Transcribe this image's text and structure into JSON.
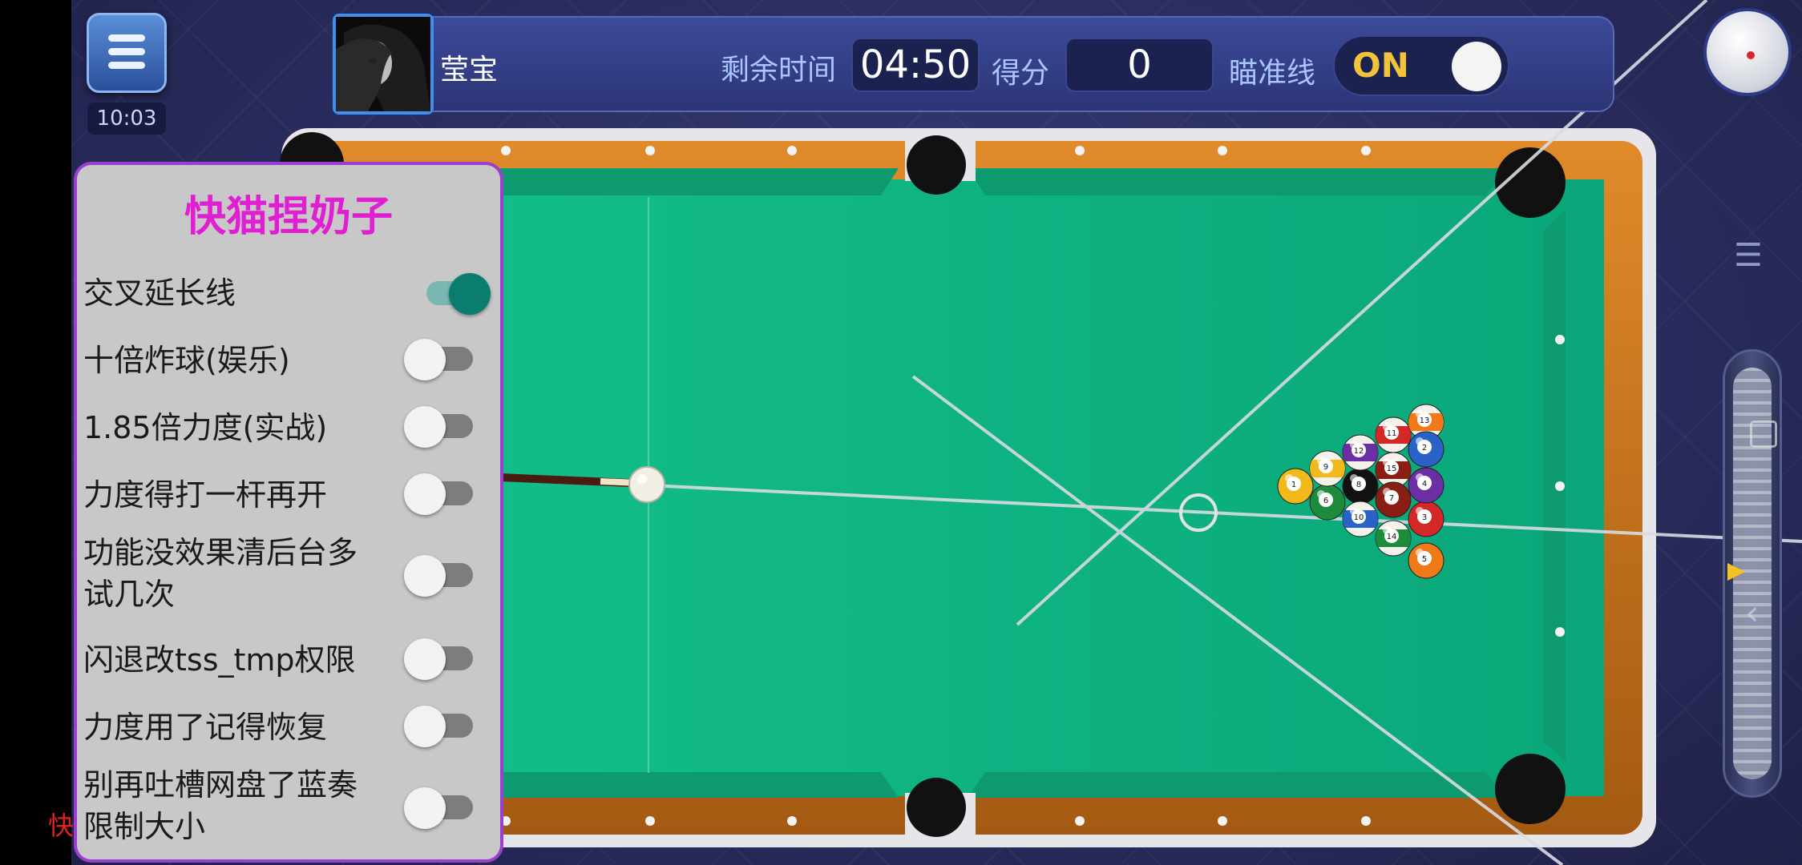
{
  "clock": "10:03",
  "player": {
    "name": "莹宝"
  },
  "timer": {
    "label": "剩余时间",
    "value": "04:50"
  },
  "score": {
    "label": "得分",
    "value": "0"
  },
  "aim_line": {
    "label": "瞄准线",
    "state": "ON"
  },
  "overlay": {
    "title": "快猫捏奶子",
    "options": [
      {
        "label": "交叉延长线",
        "enabled": true
      },
      {
        "label": "十倍炸球(娱乐)",
        "enabled": false
      },
      {
        "label": "1.85倍力度(实战)",
        "enabled": false
      },
      {
        "label": "力度得打一杆再开",
        "enabled": false
      },
      {
        "label": "功能没效果清后台多\n试几次",
        "line1": "功能没效果清后台多",
        "line2": "试几次",
        "enabled": false
      },
      {
        "label": "闪退改tss_tmp权限",
        "enabled": false
      },
      {
        "label": "力度用了记得恢复",
        "enabled": false
      },
      {
        "label": "别再吐槽网盘了蓝奏\n限制大小",
        "line1": "别再吐槽网盘了蓝奏",
        "line2": "限制大小",
        "enabled": false
      }
    ]
  },
  "corner_char": "快",
  "balls": [
    {
      "number": "1",
      "color": "#f2b91c",
      "stripe": false
    },
    {
      "number": "7",
      "color": "#8b1e14",
      "stripe": false
    },
    {
      "number": "8",
      "color": "#111111",
      "stripe": false
    },
    {
      "number": "9",
      "color": "#f2b91c",
      "stripe": true
    },
    {
      "number": "10",
      "color": "#2a62c9",
      "stripe": true
    },
    {
      "number": "11",
      "color": "#d42828",
      "stripe": true
    },
    {
      "number": "12",
      "color": "#6b2fa3",
      "stripe": true
    },
    {
      "number": "13",
      "color": "#f07a18",
      "stripe": true
    },
    {
      "number": "14",
      "color": "#1d8a3c",
      "stripe": true
    },
    {
      "number": "15",
      "color": "#8b1e14",
      "stripe": true
    },
    {
      "number": "2",
      "color": "#2a62c9",
      "stripe": false
    },
    {
      "number": "3",
      "color": "#d42828",
      "stripe": false
    },
    {
      "number": "4",
      "color": "#6b2fa3",
      "stripe": false
    },
    {
      "number": "5",
      "color": "#f07a18",
      "stripe": false
    },
    {
      "number": "6",
      "color": "#1d8a3c",
      "stripe": false
    }
  ],
  "colors": {
    "felt": "#0fb884",
    "rail": "#c8731c",
    "overlay_accent": "#9b3fd1",
    "title_magenta": "#e01ed2"
  }
}
